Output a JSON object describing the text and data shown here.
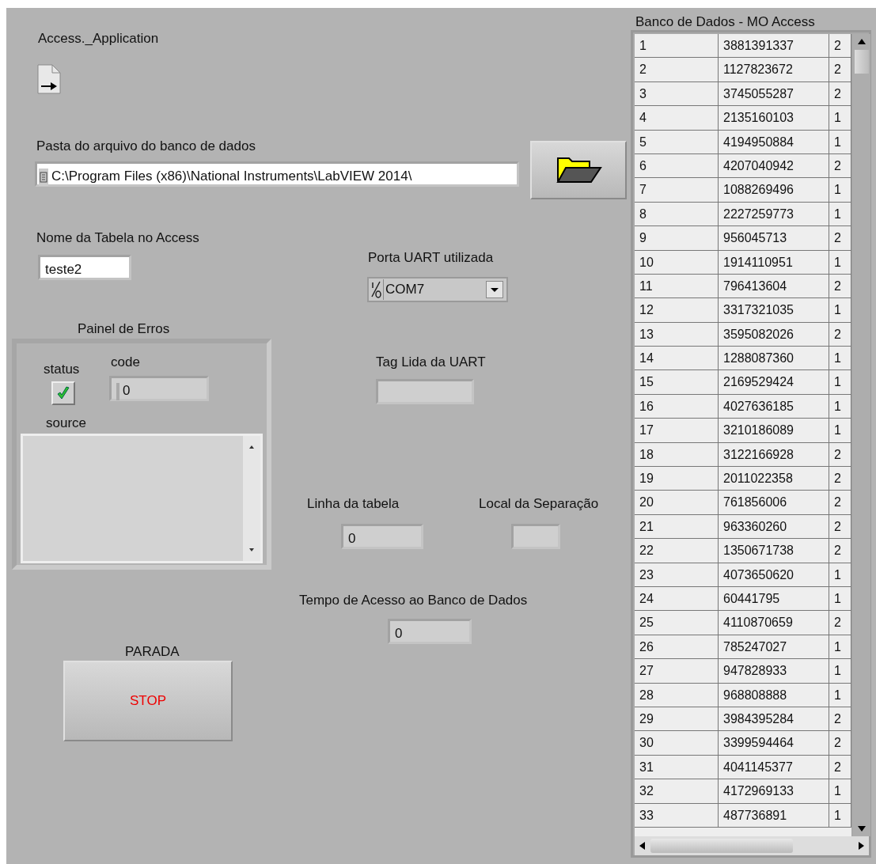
{
  "refnum": {
    "label": "Access._Application"
  },
  "folder_path": {
    "label": "Pasta do arquivo do banco de dados",
    "value": "C:\\Program Files (x86)\\National Instruments\\LabVIEW 2014\\"
  },
  "table_name": {
    "label": "Nome da Tabela no Access",
    "value": "teste2"
  },
  "uart_port": {
    "label": "Porta UART utilizada",
    "value": "COM7"
  },
  "error_panel": {
    "title": "Painel de Erros",
    "status_label": "status",
    "status": true,
    "code_label": "code",
    "code": "0",
    "source_label": "source"
  },
  "tag_read": {
    "label": "Tag Lida da UART"
  },
  "table_row": {
    "label": "Linha da tabela",
    "value": "0"
  },
  "separation": {
    "label": "Local da Separação"
  },
  "access_time": {
    "label": "Tempo de Acesso ao Banco de Dados",
    "value": "0"
  },
  "stop": {
    "label": "PARADA",
    "button": "STOP"
  },
  "table": {
    "title": "Banco de Dados - MO Access",
    "rows": [
      [
        "1",
        "3881391337",
        "2"
      ],
      [
        "2",
        "1127823672",
        "2"
      ],
      [
        "3",
        "3745055287",
        "2"
      ],
      [
        "4",
        "2135160103",
        "1"
      ],
      [
        "5",
        "4194950884",
        "1"
      ],
      [
        "6",
        "4207040942",
        "2"
      ],
      [
        "7",
        "1088269496",
        "1"
      ],
      [
        "8",
        "2227259773",
        "1"
      ],
      [
        "9",
        "956045713",
        "2"
      ],
      [
        "10",
        "1914110951",
        "1"
      ],
      [
        "11",
        "796413604",
        "2"
      ],
      [
        "12",
        "3317321035",
        "1"
      ],
      [
        "13",
        "3595082026",
        "2"
      ],
      [
        "14",
        "1288087360",
        "1"
      ],
      [
        "15",
        "2169529424",
        "1"
      ],
      [
        "16",
        "4027636185",
        "1"
      ],
      [
        "17",
        "3210186089",
        "1"
      ],
      [
        "18",
        "3122166928",
        "2"
      ],
      [
        "19",
        "2011022358",
        "2"
      ],
      [
        "20",
        "761856006",
        "2"
      ],
      [
        "21",
        "963360260",
        "2"
      ],
      [
        "22",
        "1350671738",
        "2"
      ],
      [
        "23",
        "4073650620",
        "1"
      ],
      [
        "24",
        "60441795",
        "1"
      ],
      [
        "25",
        "4110870659",
        "2"
      ],
      [
        "26",
        "785247027",
        "1"
      ],
      [
        "27",
        "947828933",
        "1"
      ],
      [
        "28",
        "968808888",
        "1"
      ],
      [
        "29",
        "3984395284",
        "2"
      ],
      [
        "30",
        "3399594464",
        "2"
      ],
      [
        "31",
        "4041145377",
        "2"
      ],
      [
        "32",
        "4172969133",
        "1"
      ],
      [
        "33",
        "487736891",
        "1"
      ]
    ]
  }
}
